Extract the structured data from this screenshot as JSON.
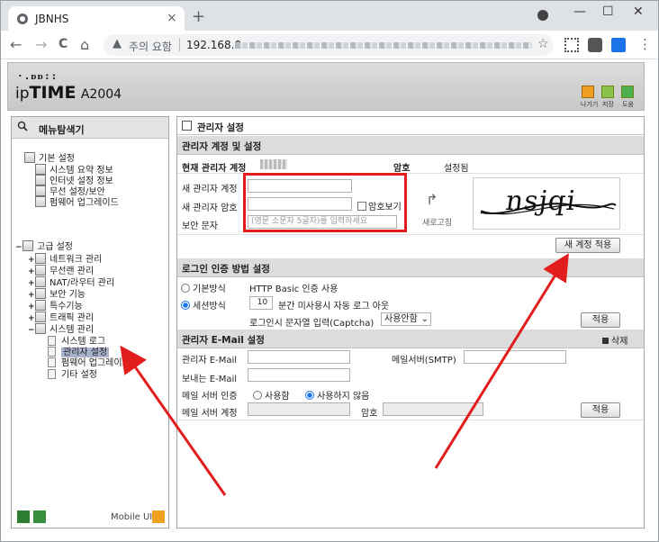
{
  "browser": {
    "tab_title": "JBNHS",
    "tab_close": "×",
    "new_tab": "+",
    "window_controls": [
      "—",
      "☐",
      "✕"
    ],
    "nav": {
      "back": "←",
      "forward": "→",
      "reload": "C",
      "home": "⌂"
    },
    "security_text": "주의 요함",
    "url": "192.168.0.",
    "star": "☆",
    "menu_dots": "⋮",
    "icons": [
      "warning-icon",
      "star-icon",
      "qr-icon",
      "puzzle-icon",
      "extension-icon",
      "menu-icon"
    ]
  },
  "header": {
    "logo_dots": "·.ᴅᴅ::",
    "brand_prefix": "ip",
    "brand_bold": "TIME",
    "model": "A2004",
    "icons": [
      {
        "name": "logout-icon",
        "label": "나가기",
        "color": "#f0a020"
      },
      {
        "name": "save-icon",
        "label": "저장",
        "color": "#8bc34a"
      },
      {
        "name": "help-icon",
        "label": "도움",
        "color": "#4caf50"
      }
    ],
    "icon_labels_line": "나가기  저장  도움"
  },
  "menu": {
    "title": "메뉴탐색기",
    "basic": {
      "label": "기본 설정",
      "items": [
        "시스템 요약 정보",
        "인터넷 설정 정보",
        "무선 설정/보안",
        "펌웨어 업그레이드"
      ]
    },
    "advanced": {
      "toggle": "−",
      "label": "고급 설정",
      "items": [
        {
          "toggle": "+",
          "label": "네트워크 관리"
        },
        {
          "toggle": "+",
          "label": "무선랜 관리"
        },
        {
          "toggle": "+",
          "label": "NAT/라우터 관리"
        },
        {
          "toggle": "+",
          "label": "보안 기능"
        },
        {
          "toggle": "+",
          "label": "특수기능"
        },
        {
          "toggle": "+",
          "label": "트래픽 관리"
        },
        {
          "toggle": "−",
          "label": "시스템 관리"
        }
      ],
      "system_items": [
        "시스템 로그",
        "관리자 설정",
        "펌웨어 업그레이드",
        "기타 설정"
      ],
      "selected": "관리자 설정"
    },
    "mobile_ui": "Mobile UI"
  },
  "main": {
    "page_title": "관리자 설정",
    "account_section": "관리자 계정 및 설정",
    "current_admin_label": "현재 관리자 계정",
    "password_label": "암호",
    "password_status": "설정됨",
    "new_admin_label": "새 관리자 계정",
    "new_password_label": "새 관리자 암호",
    "show_password_label": "암호보기",
    "captcha_label": "보안 문자",
    "captcha_placeholder": "(영문 소문자 5글자)를 입력하세요",
    "captcha_text": "nsjqi",
    "refresh_label": "새로고침",
    "apply_account_button": "새 계정 적용",
    "login_section": "로그인 인증 방법 설정",
    "basic_method": "기본방식",
    "basic_method_desc": "HTTP Basic 인증 사용",
    "session_method": "세션방식",
    "session_minutes": "10",
    "session_desc": "분간 미사용시 자동 로그 아웃",
    "captcha_login_label": "로그인시 문자열 입력(Captcha)",
    "captcha_login_value": "사용안함",
    "apply_button": "적용",
    "email_section": "관리자 E-Mail 설정",
    "delete_label": "삭제",
    "admin_email_label": "관리자 E-Mail",
    "smtp_label": "메일서버(SMTP)",
    "sender_email_label": "보내는 E-Mail",
    "mail_auth_label": "메일 서버 인증",
    "use_label": "사용함",
    "not_use_label": "사용하지 않음",
    "mail_account_label": "메일 서버 계정",
    "mail_password_label": "암호",
    "apply_button_2": "적용"
  },
  "colors": {
    "annotation_red": "#e21d1d",
    "selected_item": "#aab3cc",
    "section_bg": "#dcdcdc"
  }
}
